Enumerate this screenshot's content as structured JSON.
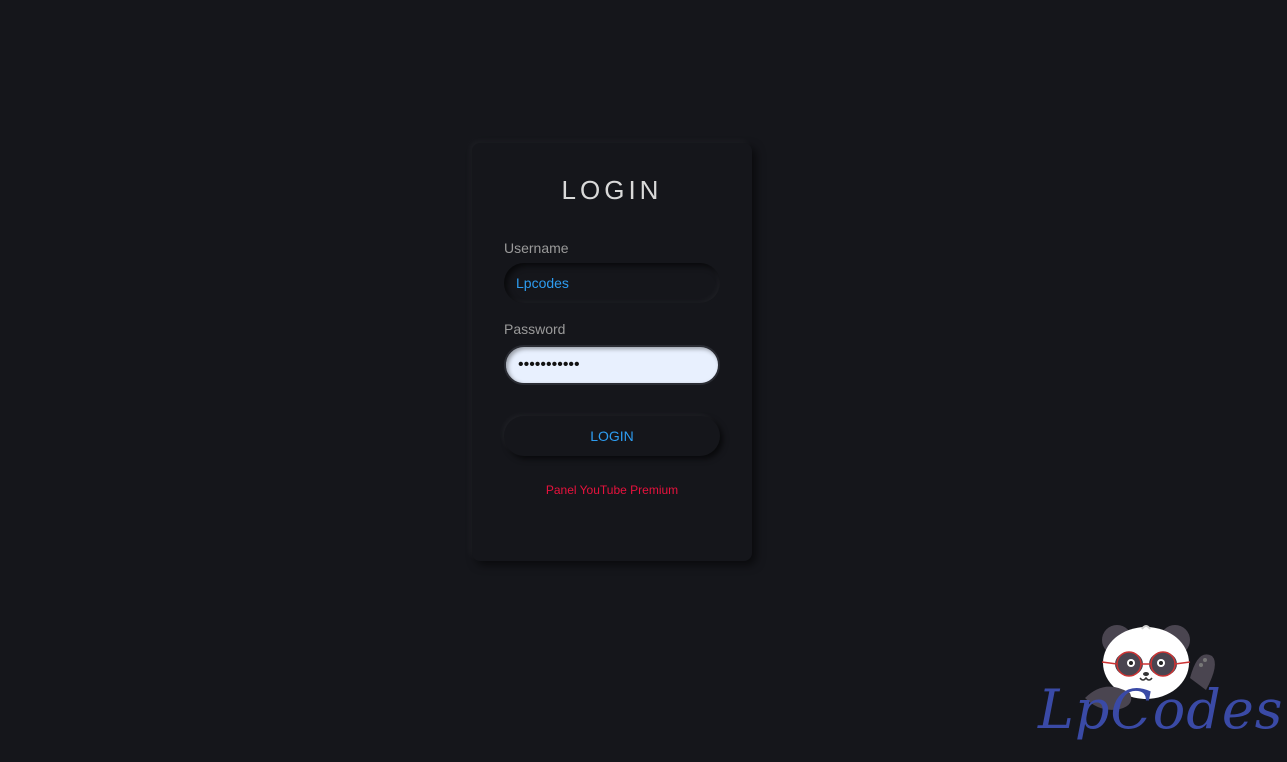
{
  "login_card": {
    "title": "LOGIN",
    "username_label": "Username",
    "username_value": "Lpcodes",
    "password_label": "Password",
    "password_value": "•••••••••••",
    "login_button": "LOGIN",
    "footer_link": "Panel YouTube Premium"
  },
  "logo": {
    "text": "LpCodes",
    "icon": "panda-mascot-icon"
  },
  "colors": {
    "background": "#15161b",
    "accent": "#2d9cf0",
    "link": "#e8123d",
    "logo": "#3a4aa6"
  }
}
